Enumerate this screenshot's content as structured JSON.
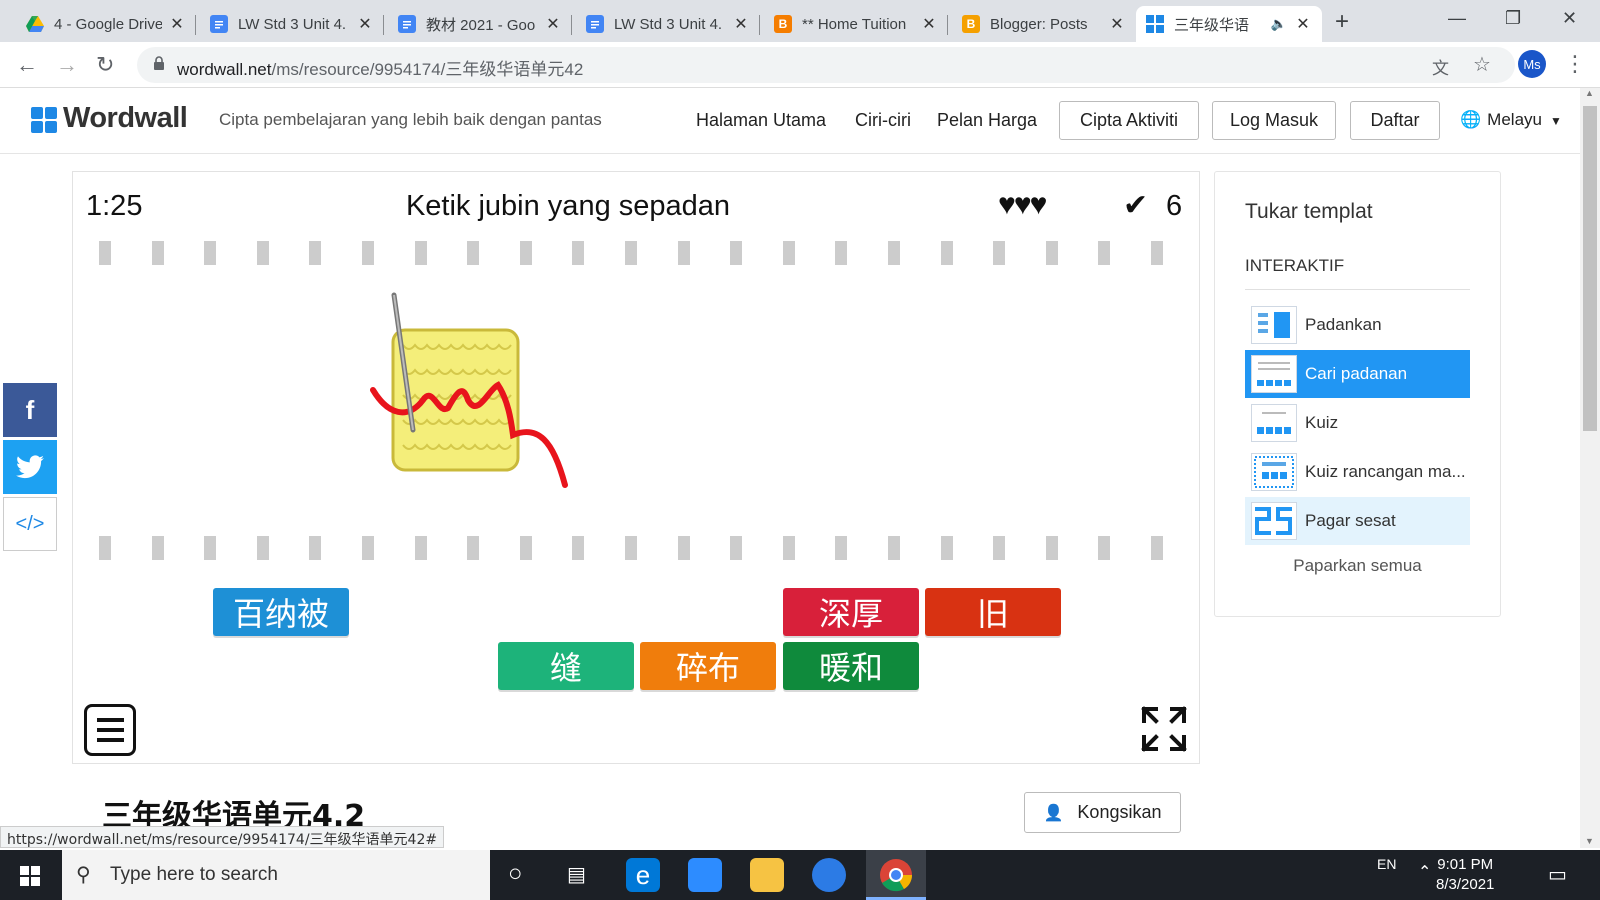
{
  "browser": {
    "tabs": [
      {
        "title": "4 - Google Drive",
        "favicon": "google-drive-icon",
        "color": "#34a853"
      },
      {
        "title": "LW Std 3 Unit 4.",
        "favicon": "google-docs-icon",
        "color": "#4285f4"
      },
      {
        "title": "教材 2021 - Goo",
        "favicon": "google-docs-icon",
        "color": "#4285f4"
      },
      {
        "title": "LW Std 3 Unit 4.",
        "favicon": "google-docs-icon",
        "color": "#4285f4"
      },
      {
        "title": "** Home Tuition",
        "favicon": "blogger-icon",
        "color": "#f57d00"
      },
      {
        "title": "Blogger: Posts",
        "favicon": "blogger-icon",
        "color": "#f57d00"
      },
      {
        "title": "三年级华语",
        "favicon": "wordwall-icon",
        "color": "#1e88e5"
      }
    ],
    "url_host": "wordwall.net",
    "url_path": "/ms/resource/9954174/三年级华语单元42",
    "profile_initials": "Ms"
  },
  "site": {
    "logo_text": "Wordwall",
    "tagline": "Cipta pembelajaran yang lebih baik dengan pantas",
    "nav": [
      "Halaman Utama",
      "Ciri-ciri",
      "Pelan Harga"
    ],
    "buttons": {
      "create": "Cipta Aktiviti",
      "login": "Log Masuk",
      "signup": "Daftar"
    },
    "language": "Melayu"
  },
  "game": {
    "timer": "1:25",
    "title": "Ketik jubin yang sepadan",
    "lives": "♥♥♥",
    "score": "6",
    "tiles": [
      {
        "label": "百纳被",
        "color": "#1e90d6"
      },
      {
        "label": "深厚",
        "color": "#d8203a"
      },
      {
        "label": "旧",
        "color": "#d83212"
      },
      {
        "label": "缝",
        "color": "#1db37a"
      },
      {
        "label": "碎布",
        "color": "#f07d0c"
      },
      {
        "label": "暖和",
        "color": "#0f8a3c"
      }
    ]
  },
  "sidebar": {
    "title": "Tukar templat",
    "section": "INTERAKTIF",
    "items": [
      "Padankan",
      "Cari padanan",
      "Kuiz",
      "Kuiz rancangan ma...",
      "Pagar sesat"
    ],
    "show_all": "Paparkan semua"
  },
  "page": {
    "title": "三年级华语单元4.2",
    "share": "Kongsikan",
    "status_url": "https://wordwall.net/ms/resource/9954174/三年级华语单元42#"
  },
  "taskbar": {
    "search_placeholder": "Type here to search",
    "lang": "EN",
    "time": "9:01 PM",
    "date": "8/3/2021"
  }
}
